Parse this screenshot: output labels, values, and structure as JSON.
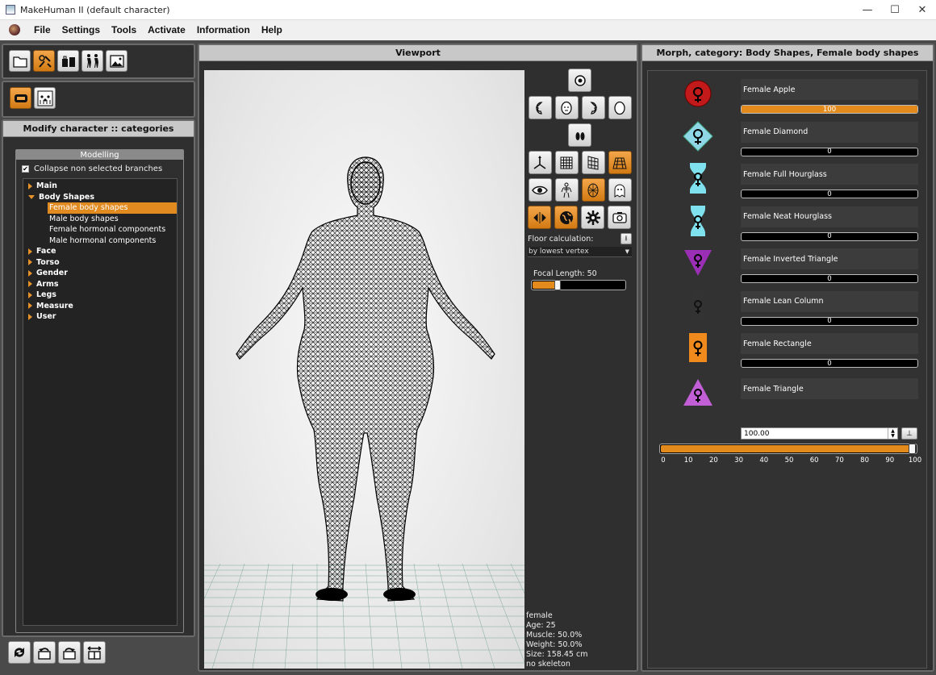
{
  "window": {
    "title": "MakeHuman II (default character)",
    "minimize": "—",
    "maximize": "☐",
    "close": "✕"
  },
  "menu": [
    "File",
    "Settings",
    "Tools",
    "Activate",
    "Information",
    "Help"
  ],
  "left": {
    "header": "Modify character :: categories",
    "modelling_title": "Modelling",
    "collapse_label": "Collapse non selected branches",
    "collapse_checked": "✔",
    "tree": {
      "main": "Main",
      "body_shapes": "Body Shapes",
      "female_body_shapes": "Female body shapes",
      "male_body_shapes": "Male body shapes",
      "female_hormonal": "Female hormonal components",
      "male_hormonal": "Male hormonal components",
      "face": "Face",
      "torso": "Torso",
      "gender": "Gender",
      "arms": "Arms",
      "legs": "Legs",
      "measure": "Measure",
      "user": "User"
    }
  },
  "viewport": {
    "header": "Viewport",
    "floor_calc_label": "Floor calculation:",
    "floor_calc_value": "by lowest vertex",
    "focal_label": "Focal Length: 50",
    "focal_value": 0.24,
    "info": {
      "gender": "female",
      "age": "Age: 25",
      "muscle": "Muscle: 50.0%",
      "weight": "Weight: 50.0%",
      "size": "Size: 158.45 cm",
      "skeleton": "no skeleton"
    }
  },
  "right": {
    "header": "Morph, category: Body Shapes, Female body shapes",
    "morphs": [
      {
        "label": "Female Apple",
        "value": "100",
        "fill": 1.0,
        "color": "#c21a1a"
      },
      {
        "label": "Female Diamond",
        "value": "0",
        "fill": 0,
        "color": "#8fd6e6"
      },
      {
        "label": "Female Full Hourglass",
        "value": "0",
        "fill": 0,
        "color": "#7fe0ee"
      },
      {
        "label": "Female Neat Hourglass",
        "value": "0",
        "fill": 0,
        "color": "#7fe0ee"
      },
      {
        "label": "Female Inverted Triangle",
        "value": "0",
        "fill": 0,
        "color": "#9a2fb5"
      },
      {
        "label": "Female Lean Column",
        "value": "0",
        "fill": 0,
        "color": "#333333"
      },
      {
        "label": "Female Rectangle",
        "value": "0",
        "fill": 0,
        "color": "#f08a1d"
      },
      {
        "label": "Female Triangle",
        "value": "",
        "fill": 0,
        "color": "#c35fd6"
      }
    ],
    "spin_value": "100.00",
    "slider_value": 100,
    "ticks": [
      "0",
      "10",
      "20",
      "30",
      "40",
      "50",
      "60",
      "70",
      "80",
      "90",
      "100"
    ]
  },
  "colors": {
    "accent": "#e38a1d",
    "panel": "#2f2f2f",
    "background": "#4a4a4a"
  }
}
